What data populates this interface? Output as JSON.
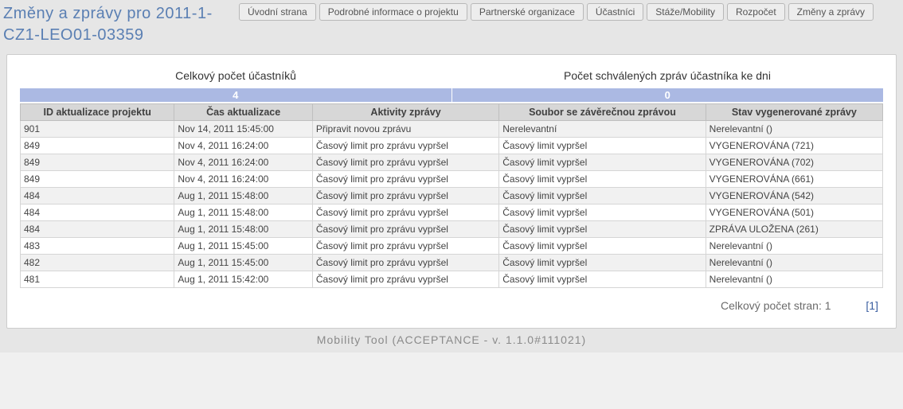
{
  "title": "Změny a zprávy pro 2011-1-CZ1-LEO01-03359",
  "tabs": [
    "Úvodní strana",
    "Podrobné informace o projektu",
    "Partnerské organizace",
    "Účastníci",
    "Stáže/Mobility",
    "Rozpočet",
    "Změny a zprávy"
  ],
  "summary": {
    "left_label": "Celkový počet účastníků",
    "left_value": "4",
    "right_label": "Počet schválených zpráv účastníka ke dni",
    "right_value": "0"
  },
  "headers": [
    "ID aktualizace projektu",
    "Čas aktualizace",
    "Aktivity zprávy",
    "Soubor se závěrečnou zprávou",
    "Stav vygenerované zprávy"
  ],
  "rows": [
    {
      "c0": "901",
      "c1": "Nov 14, 2011 15:45:00",
      "c2": "Připravit novou zprávu",
      "c3": "Nerelevantní",
      "c4": "Nerelevantní ()"
    },
    {
      "c0": "849",
      "c1": "Nov 4, 2011 16:24:00",
      "c2": "Časový limit pro zprávu vypršel",
      "c3": "Časový limit vypršel",
      "c4": "VYGENEROVÁNA (721)"
    },
    {
      "c0": "849",
      "c1": "Nov 4, 2011 16:24:00",
      "c2": "Časový limit pro zprávu vypršel",
      "c3": "Časový limit vypršel",
      "c4": "VYGENEROVÁNA (702)"
    },
    {
      "c0": "849",
      "c1": "Nov 4, 2011 16:24:00",
      "c2": "Časový limit pro zprávu vypršel",
      "c3": "Časový limit vypršel",
      "c4": "VYGENEROVÁNA (661)"
    },
    {
      "c0": "484",
      "c1": "Aug 1, 2011 15:48:00",
      "c2": "Časový limit pro zprávu vypršel",
      "c3": "Časový limit vypršel",
      "c4": "VYGENEROVÁNA (542)"
    },
    {
      "c0": "484",
      "c1": "Aug 1, 2011 15:48:00",
      "c2": "Časový limit pro zprávu vypršel",
      "c3": "Časový limit vypršel",
      "c4": "VYGENEROVÁNA (501)"
    },
    {
      "c0": "484",
      "c1": "Aug 1, 2011 15:48:00",
      "c2": "Časový limit pro zprávu vypršel",
      "c3": "Časový limit vypršel",
      "c4": "ZPRÁVA ULOŽENA (261)"
    },
    {
      "c0": "483",
      "c1": "Aug 1, 2011 15:45:00",
      "c2": "Časový limit pro zprávu vypršel",
      "c3": "Časový limit vypršel",
      "c4": "Nerelevantní ()"
    },
    {
      "c0": "482",
      "c1": "Aug 1, 2011 15:45:00",
      "c2": "Časový limit pro zprávu vypršel",
      "c3": "Časový limit vypršel",
      "c4": "Nerelevantní ()"
    },
    {
      "c0": "481",
      "c1": "Aug 1, 2011 15:42:00",
      "c2": "Časový limit pro zprávu vypršel",
      "c3": "Časový limit vypršel",
      "c4": "Nerelevantní ()"
    }
  ],
  "pager": {
    "total_label": "Celkový počet stran: 1",
    "current": "[1]"
  },
  "footer": "Mobility Tool (ACCEPTANCE - v. 1.1.0#111021)"
}
